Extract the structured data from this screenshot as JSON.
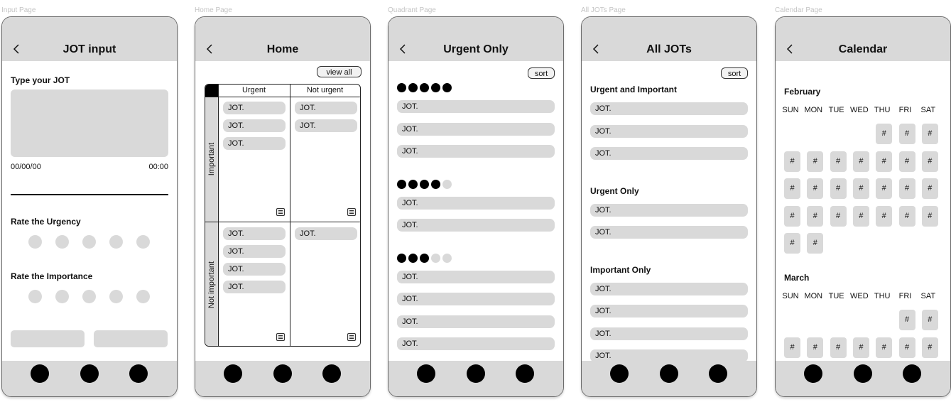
{
  "frame_labels": [
    "Input Page",
    "Home Page",
    "Quadrant Page",
    "All JOTs Page",
    "Calendar Page"
  ],
  "icons": {
    "back": "chevron-left-icon",
    "menu": "hamburger-menu-icon",
    "nav": "nav-circle-icon"
  },
  "colors": {
    "panel": "#d9d9d9",
    "dark": "#000000",
    "frame_border": "#6a6a6a"
  },
  "input_page": {
    "title": "JOT input",
    "type_label": "Type your JOT",
    "date": "00/00/00",
    "time": "00:00",
    "urgency_label": "Rate the Urgency",
    "importance_label": "Rate the Importance",
    "rating_dots": 5
  },
  "home_page": {
    "title": "Home",
    "view_all": "view all",
    "col_urgent": "Urgent",
    "col_not_urgent": "Not urgent",
    "row_important": "Important",
    "row_not_important": "Not important",
    "quadrants": {
      "important_urgent": [
        "JOT.",
        "JOT.",
        "JOT."
      ],
      "important_not_urgent": [
        "JOT.",
        "JOT."
      ],
      "not_important_urgent": [
        "JOT.",
        "JOT.",
        "JOT.",
        "JOT."
      ],
      "not_important_not_urgent": [
        "JOT."
      ]
    }
  },
  "quadrant_page": {
    "title": "Urgent Only",
    "sort": "sort",
    "groups": [
      {
        "level": 5,
        "items": [
          "JOT.",
          "JOT.",
          "JOT."
        ]
      },
      {
        "level": 4,
        "items": [
          "JOT.",
          "JOT."
        ]
      },
      {
        "level": 3,
        "items": [
          "JOT.",
          "JOT.",
          "JOT.",
          "JOT."
        ]
      }
    ]
  },
  "all_jots_page": {
    "title": "All JOTs",
    "sort": "sort",
    "sections": [
      {
        "label": "Urgent and Important",
        "items": [
          "JOT.",
          "JOT.",
          "JOT."
        ]
      },
      {
        "label": "Urgent Only",
        "items": [
          "JOT.",
          "JOT."
        ]
      },
      {
        "label": "Important Only",
        "items": [
          "JOT.",
          "JOT.",
          "JOT.",
          "JOT."
        ]
      }
    ]
  },
  "calendar_page": {
    "title": "Calendar",
    "weekdays": [
      "SUN",
      "MON",
      "TUE",
      "WED",
      "THU",
      "FRI",
      "SAT"
    ],
    "months": [
      {
        "name": "February",
        "first_weekday": 4,
        "cells": 26,
        "cell_label": "#"
      },
      {
        "name": "March",
        "first_weekday": 5,
        "cells": 9,
        "cell_label": "#"
      }
    ]
  }
}
